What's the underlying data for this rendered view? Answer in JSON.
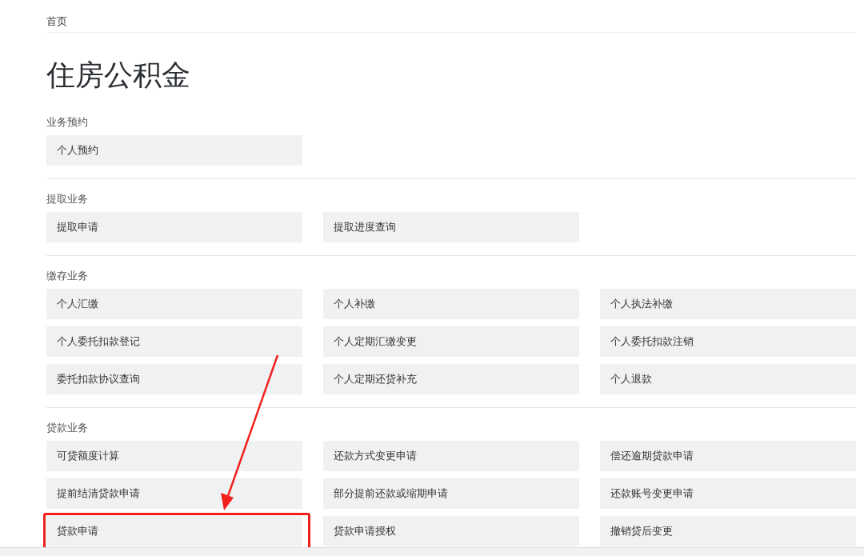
{
  "breadcrumb": "首页",
  "title": "住房公积金",
  "sections": [
    {
      "label": "业务预约",
      "items": [
        {
          "label": "个人预约",
          "highlighted": false
        }
      ]
    },
    {
      "label": "提取业务",
      "items": [
        {
          "label": "提取申请",
          "highlighted": false
        },
        {
          "label": "提取进度查询",
          "highlighted": false
        }
      ]
    },
    {
      "label": "缴存业务",
      "items": [
        {
          "label": "个人汇缴",
          "highlighted": false
        },
        {
          "label": "个人补缴",
          "highlighted": false
        },
        {
          "label": "个人执法补缴",
          "highlighted": false
        },
        {
          "label": "个人委托扣款登记",
          "highlighted": false
        },
        {
          "label": "个人定期汇缴变更",
          "highlighted": false
        },
        {
          "label": "个人委托扣款注销",
          "highlighted": false
        },
        {
          "label": "委托扣款协议查询",
          "highlighted": false
        },
        {
          "label": "个人定期还贷补充",
          "highlighted": false
        },
        {
          "label": "个人退款",
          "highlighted": false
        }
      ]
    },
    {
      "label": "贷款业务",
      "items": [
        {
          "label": "可贷额度计算",
          "highlighted": false
        },
        {
          "label": "还款方式变更申请",
          "highlighted": false
        },
        {
          "label": "偿还逾期贷款申请",
          "highlighted": false
        },
        {
          "label": "提前结清贷款申请",
          "highlighted": false
        },
        {
          "label": "部分提前还款或缩期申请",
          "highlighted": false
        },
        {
          "label": "还款账号变更申请",
          "highlighted": false
        },
        {
          "label": "贷款申请",
          "highlighted": true
        },
        {
          "label": "贷款申请授权",
          "highlighted": false
        },
        {
          "label": "撤销贷后变更",
          "highlighted": false
        }
      ]
    }
  ]
}
